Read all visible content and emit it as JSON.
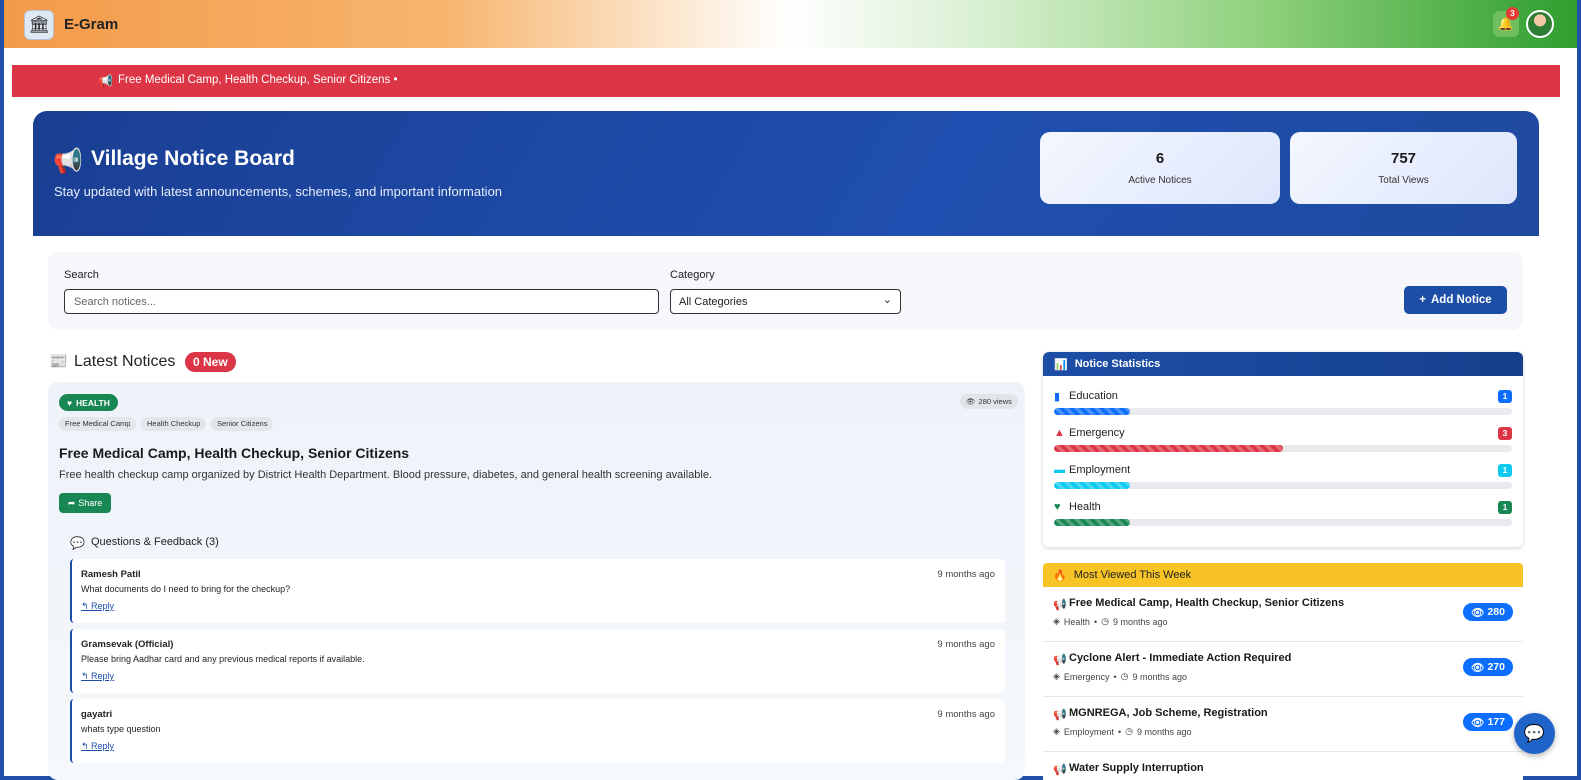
{
  "header": {
    "brand": "E-Gram",
    "notification_count": "3",
    "icons": {
      "logo": "emblem-logo",
      "bell": "bell-icon",
      "avatar": "user-avatar"
    }
  },
  "ticker": {
    "text": "Free Medical Camp, Health Checkup, Senior Citizens •",
    "icon": "megaphone-icon"
  },
  "hero": {
    "title": "Village Notice Board",
    "subtitle": "Stay updated with latest announcements, schemes, and important information",
    "stats": [
      {
        "value": "6",
        "label": "Active Notices"
      },
      {
        "value": "757",
        "label": "Total Views"
      }
    ]
  },
  "filters": {
    "search_label": "Search",
    "search_placeholder": "Search notices...",
    "search_value": "",
    "category_label": "Category",
    "category_selected": "All Categories",
    "add_button": "Add Notice"
  },
  "latest": {
    "title": "Latest Notices",
    "new_badge": "0 New"
  },
  "notice": {
    "category": "HEALTH",
    "views": "280 views",
    "tags": [
      "Free Medical Camp",
      "Health Checkup",
      "Senior Citizens"
    ],
    "title": "Free Medical Camp, Health Checkup, Senior Citizens",
    "description": "Free health checkup camp organized by District Health Department. Blood pressure, diabetes, and general health screening available.",
    "share_label": "Share",
    "feedback_title": "Questions & Feedback (3)",
    "comments": [
      {
        "author": "Ramesh Patil",
        "time": "9 months ago",
        "text": "What documents do I need to bring for the checkup?",
        "reply": "Reply"
      },
      {
        "author": "Gramsevak (Official)",
        "time": "9 months ago",
        "text": "Please bring Aadhar card and any previous medical reports if available.",
        "reply": "Reply"
      },
      {
        "author": "gayatri",
        "time": "9 months ago",
        "text": "whats type question",
        "reply": "Reply"
      }
    ]
  },
  "statistics": {
    "title": "Notice Statistics",
    "rows": [
      {
        "label": "Education",
        "count": "1",
        "fraction": 0.167,
        "color": "#0d6efd",
        "icon": "book-icon"
      },
      {
        "label": "Emergency",
        "count": "3",
        "fraction": 0.5,
        "color": "#dc3545",
        "icon": "warning-icon"
      },
      {
        "label": "Employment",
        "count": "1",
        "fraction": 0.167,
        "color": "#0dcaf0",
        "icon": "briefcase-icon"
      },
      {
        "label": "Health",
        "count": "1",
        "fraction": 0.167,
        "color": "#198754",
        "icon": "heart-pulse-icon"
      }
    ]
  },
  "most_viewed": {
    "title": "Most Viewed This Week",
    "items": [
      {
        "title": "Free Medical Camp, Health Checkup, Senior Citizens",
        "category": "Health",
        "time": "9 months ago",
        "views": "280"
      },
      {
        "title": "Cyclone Alert - Immediate Action Required",
        "category": "Emergency",
        "time": "9 months ago",
        "views": "270"
      },
      {
        "title": "MGNREGA, Job Scheme, Registration",
        "category": "Employment",
        "time": "9 months ago",
        "views": "177"
      },
      {
        "title": "Water Supply Interruption",
        "category": "",
        "time": "",
        "views": ""
      }
    ]
  }
}
